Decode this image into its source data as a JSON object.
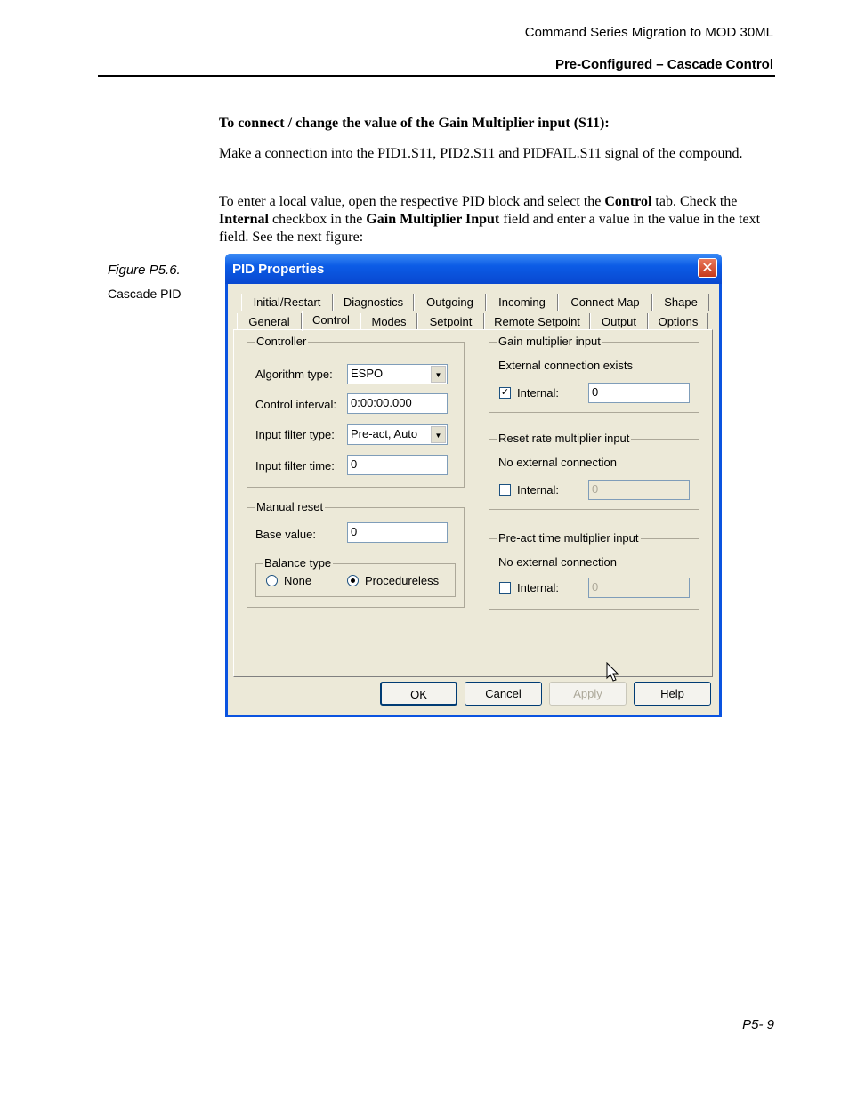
{
  "header": {
    "doc_title": "Command Series Migration to MOD 30ML",
    "section_title": "Pre-Configured – Cascade Control"
  },
  "body": {
    "heading": "To connect / change the value of the Gain Multiplier input (S11):",
    "para1": "Make a connection into the PID1.S11, PID2.S11 and PIDFAIL.S11 signal of the compound.",
    "para2": {
      "t1": "To enter a local value, open the respective PID block and select the ",
      "b1": "Control",
      "t2": " tab. Check the ",
      "b2": "Internal",
      "t3": " checkbox in the ",
      "b3": "Gain Multiplier Input",
      "t4": " field and enter a value in the value in the text field. See the next figure:"
    }
  },
  "figure": {
    "label": "Figure P5.6.",
    "caption": "Cascade PID"
  },
  "dialog": {
    "title": "PID Properties",
    "close_glyph": "✕",
    "tabs_row1": [
      "Initial/Restart",
      "Diagnostics",
      "Outgoing",
      "Incoming",
      "Connect Map",
      "Shape"
    ],
    "tabs_row2": [
      "General",
      "Control",
      "Modes",
      "Setpoint",
      "Remote Setpoint",
      "Output",
      "Options"
    ],
    "selected_tab": "Control",
    "controller": {
      "title": "Controller",
      "algorithm_label": "Algorithm type:",
      "algorithm_value": "ESPO",
      "interval_label": "Control interval:",
      "interval_value": "0:00:00.000",
      "filter_type_label": "Input filter type:",
      "filter_type_value": "Pre-act, Auto",
      "filter_time_label": "Input filter time:",
      "filter_time_value": "0"
    },
    "manual_reset": {
      "title": "Manual reset",
      "base_label": "Base value:",
      "base_value": "0",
      "balance_title": "Balance type",
      "opt_none": "None",
      "opt_proc": "Procedureless",
      "selected": "Procedureless"
    },
    "gain": {
      "title": "Gain multiplier input",
      "status": "External connection exists",
      "internal_label": "Internal:",
      "internal_checked": true,
      "value": "0"
    },
    "reset_rate": {
      "title": "Reset rate multiplier input",
      "status": "No external connection",
      "internal_label": "Internal:",
      "internal_checked": false,
      "value": "0"
    },
    "preact": {
      "title": "Pre-act time multiplier input",
      "status": "No external connection",
      "internal_label": "Internal:",
      "internal_checked": false,
      "value": "0"
    },
    "buttons": {
      "ok": "OK",
      "cancel": "Cancel",
      "apply": "Apply",
      "help": "Help"
    },
    "check_glyph": "✓",
    "combo_arrow_glyph": "▼"
  },
  "footer": {
    "page": "P5- 9"
  }
}
